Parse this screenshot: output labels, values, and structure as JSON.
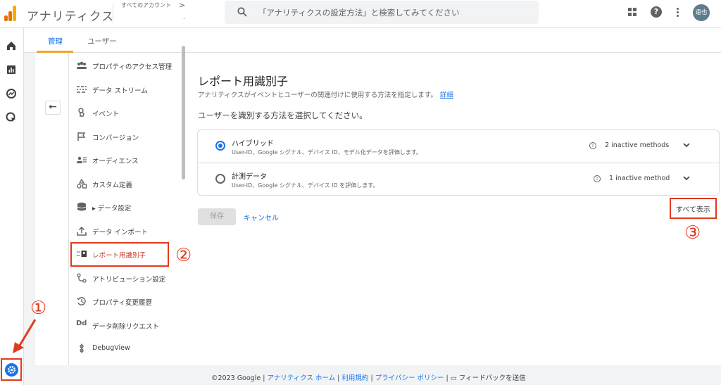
{
  "header": {
    "app_title": "アナリティクス",
    "account_label": "すべてのアカウント",
    "account_chevron": ">",
    "account_dot": ".",
    "search_placeholder": "「アナリティクスの設定方法」と検索してみてください",
    "avatar_text": "遠也",
    "help_glyph": "?"
  },
  "tabs": [
    {
      "label": "管理",
      "active": true
    },
    {
      "label": "ユーザー",
      "active": false
    }
  ],
  "menu": {
    "back_glyph": "←",
    "items": [
      {
        "label": "プロパティのアクセス管理",
        "icon": "people-icon"
      },
      {
        "label": "データ ストリーム",
        "icon": "data-stream-icon"
      },
      {
        "label": "イベント",
        "icon": "event-touch-icon"
      },
      {
        "label": "コンバージョン",
        "icon": "flag-icon"
      },
      {
        "label": "オーディエンス",
        "icon": "audience-icon"
      },
      {
        "label": "カスタム定義",
        "icon": "shapes-icon"
      },
      {
        "label": "▸ データ設定",
        "icon": "database-icon"
      },
      {
        "label": "データ インポート",
        "icon": "upload-icon"
      },
      {
        "label": "レポート用識別子",
        "icon": "report-identity-icon",
        "active": true
      },
      {
        "label": "アトリビューション設定",
        "icon": "attribution-icon"
      },
      {
        "label": "プロパティ変更履歴",
        "icon": "history-icon"
      },
      {
        "label": "データ削除リクエスト",
        "icon": "data-delete-icon",
        "glyph": "Dd"
      },
      {
        "label": "DebugView",
        "icon": "debug-icon"
      }
    ]
  },
  "content": {
    "title": "レポート用識別子",
    "description": "アナリティクスがイベントとユーザーの関連付けに使用する方法を指定します。",
    "detail_link": "詳細",
    "subtitle": "ユーザーを識別する方法を選択してください。",
    "options": [
      {
        "title": "ハイブリッド",
        "description": "User-ID、Google シグナル、デバイス ID、モデル化データを評価します。",
        "status": "2 inactive methods",
        "selected": true
      },
      {
        "title": "計測データ",
        "description": "User-ID、Google シグナル、デバイス ID を評価します。",
        "status": "1 inactive method",
        "selected": false
      }
    ],
    "info_glyph": "i",
    "save_label": "保存",
    "cancel_label": "キャンセル",
    "show_all_label": "すべて表示"
  },
  "annotations": {
    "num1": "①",
    "num2": "②",
    "num3": "③"
  },
  "footer": {
    "copyright": "©2023 Google",
    "sep": " | ",
    "home": "アナリティクス ホーム",
    "terms": "利用規約",
    "privacy": "プライバシー ポリシー",
    "feedback": "フィードバックを送信"
  },
  "colors": {
    "accent": "#1a73e8",
    "annotation_red": "#e03a1e",
    "tab_underline": "#f5a623"
  }
}
